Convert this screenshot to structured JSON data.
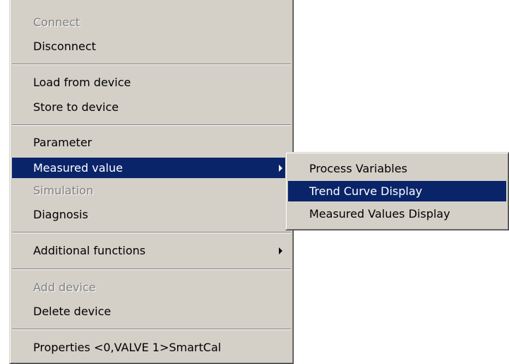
{
  "main_menu": {
    "connect": "Connect",
    "disconnect": "Disconnect",
    "load_from_device": "Load from device",
    "store_to_device": "Store to device",
    "parameter": "Parameter",
    "measured_value": "Measured value",
    "simulation": "Simulation",
    "diagnosis": "Diagnosis",
    "additional_functions": "Additional functions",
    "add_device": "Add device",
    "delete_device": "Delete device",
    "properties": "Properties <0,VALVE 1>SmartCal"
  },
  "submenu": {
    "process_variables": "Process Variables",
    "trend_curve_display": "Trend Curve Display",
    "measured_values_display": "Measured Values Display"
  },
  "colors": {
    "menu_background": "#d4d0c8",
    "highlight": "#0a246a",
    "disabled_text": "#808080"
  },
  "icons": {
    "submenu_arrow": "chevron-right-icon"
  }
}
